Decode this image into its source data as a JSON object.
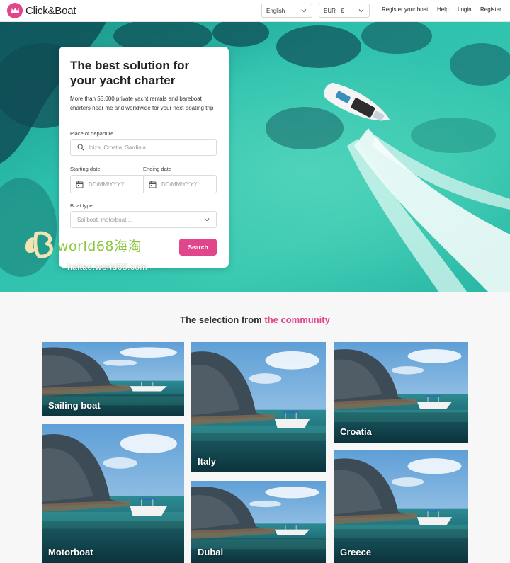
{
  "header": {
    "logo_text": "Click&Boat",
    "language": "English",
    "currency": "EUR · €",
    "links": {
      "register_boat": "Register your boat",
      "help": "Help",
      "login": "Login",
      "register": "Register"
    }
  },
  "search": {
    "title": "The best solution for your yacht charter",
    "description": "More than 55,000 private yacht rentals and bareboat charters near me and worldwide for your next boating trip",
    "departure_label": "Place of departure",
    "departure_placeholder": "Ibiza, Croatia, Sardinia...",
    "start_label": "Starting date",
    "end_label": "Ending date",
    "date_placeholder": "DD/MM/YYYY",
    "boat_type_label": "Boat type",
    "boat_type_placeholder": "Sailboat, motorboat,...",
    "button": "Search"
  },
  "watermark": {
    "text": "world68海淘",
    "sub": "haitao.world68.com"
  },
  "community": {
    "title_prefix": "The selection from ",
    "title_accent": "the community",
    "tiles": [
      "Sailing boat",
      "Italy",
      "Croatia",
      "Motorboat",
      "Dubai",
      "Greece"
    ]
  },
  "colors": {
    "brand": "#e1458b",
    "sea": "#2fb9a8",
    "watermark": "#8cc63f"
  }
}
